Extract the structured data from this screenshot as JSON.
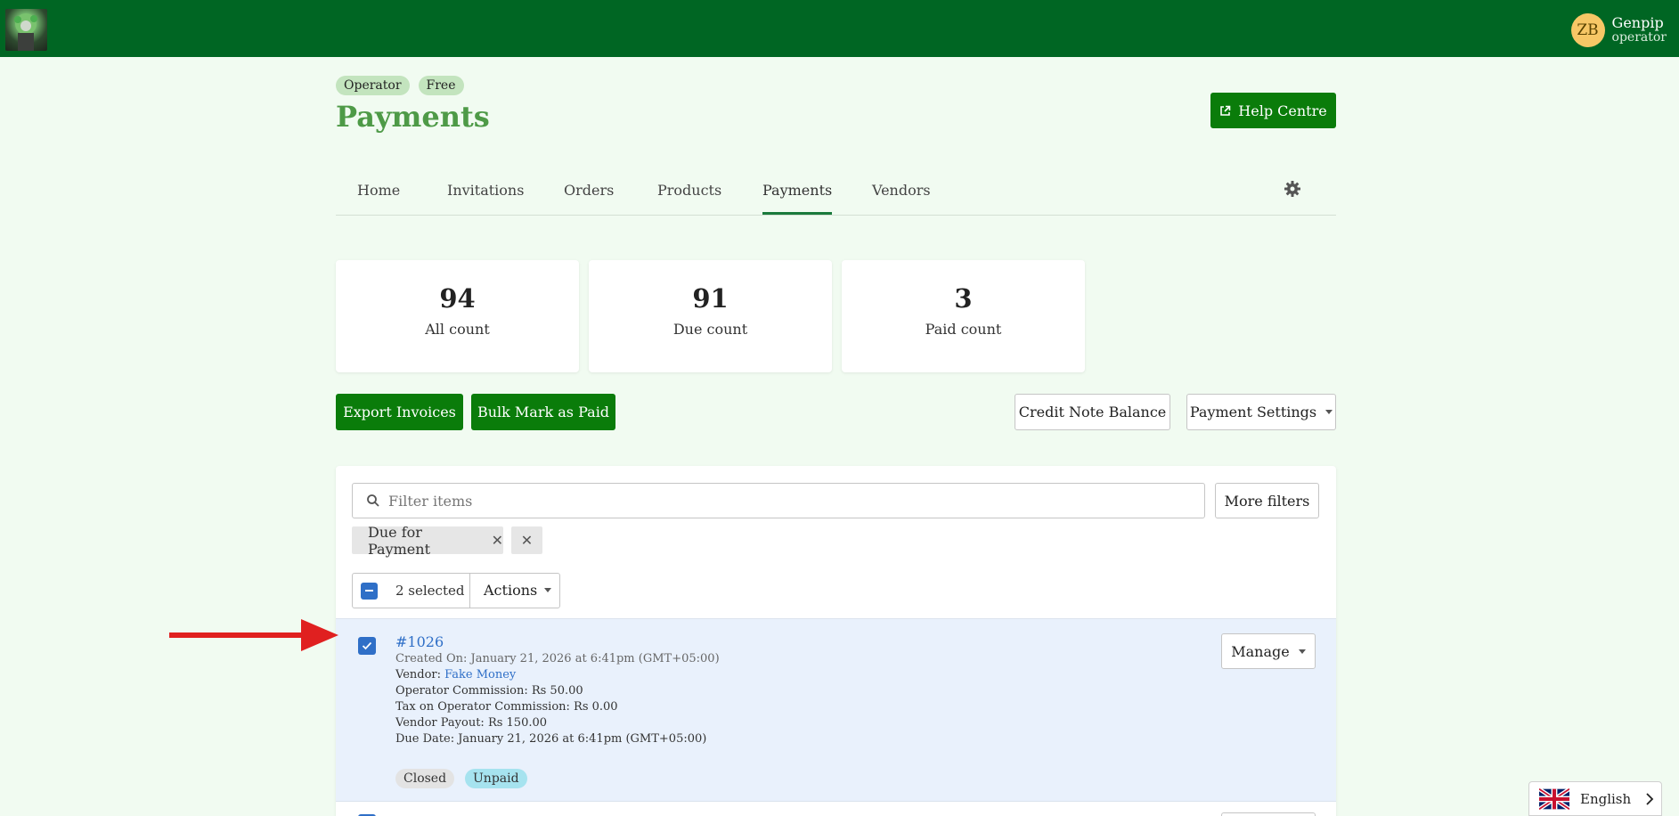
{
  "header": {
    "user": {
      "initials": "ZB",
      "name": "Genpip",
      "role": "operator"
    },
    "badges": [
      "Operator",
      "Free"
    ],
    "title": "Payments",
    "help_label": "Help Centre"
  },
  "tabs": [
    "Home",
    "Invitations",
    "Orders",
    "Products",
    "Payments",
    "Vendors"
  ],
  "active_tab": "Payments",
  "stats": [
    {
      "value": "94",
      "label": "All count"
    },
    {
      "value": "91",
      "label": "Due count"
    },
    {
      "value": "3",
      "label": "Paid count"
    }
  ],
  "toolbar": {
    "export_label": "Export Invoices",
    "bulk_label": "Bulk Mark as Paid",
    "credit_label": "Credit Note Balance",
    "settings_label": "Payment Settings"
  },
  "filters": {
    "placeholder": "Filter items",
    "more_label": "More filters",
    "chip_label": "Due for Payment",
    "chip_close": "✕",
    "clear_all": "✕"
  },
  "selection": {
    "count_label": "2 selected",
    "actions_label": "Actions"
  },
  "payment": {
    "id": "#1026",
    "created": "Created On: January 21, 2026 at 6:41pm (GMT+05:00)",
    "vendor_label": "Vendor: ",
    "vendor_name": "Fake Money",
    "commission": "Operator Commission: Rs 50.00",
    "tax": "Tax on Operator Commission: Rs 0.00",
    "payout": "Vendor Payout: Rs 150.00",
    "due": "Due Date: January 21, 2026 at 6:41pm (GMT+05:00)",
    "status_tags": [
      "Closed",
      "Unpaid"
    ],
    "manage_label": "Manage"
  },
  "language": {
    "label": "English"
  },
  "colors": {
    "brand": "#006623",
    "primary_button": "#0a7c0a",
    "title": "#4e9a47",
    "link": "#2f6fc7",
    "closed_tag": "#e3e3e3",
    "unpaid_tag": "#a6e3ef",
    "arrow": "#e02020"
  }
}
